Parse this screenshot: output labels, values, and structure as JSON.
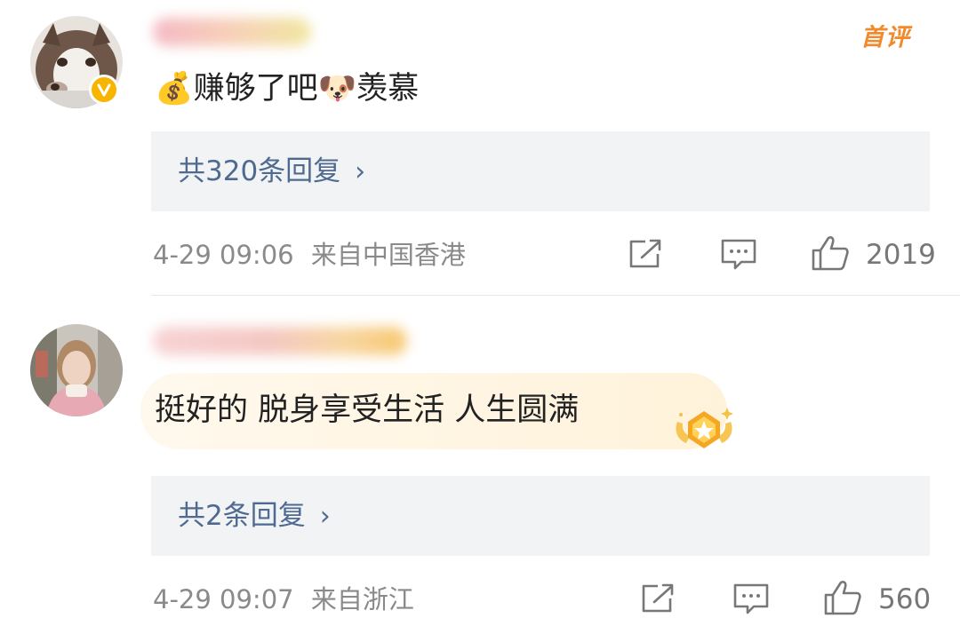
{
  "comments": [
    {
      "badge": "首评",
      "prefix_emoji": "💰",
      "text_part1": "赚够了吧",
      "inline_emoji": "🐶",
      "text_part2": "羡慕",
      "replies_label": "共320条回复",
      "timestamp": "4-29 09:06",
      "location": "来自中国香港",
      "like_count": "2019",
      "verified": true
    },
    {
      "text": "挺好的 脱身享受生活 人生圆满",
      "replies_label": "共2条回复",
      "timestamp": "4-29 09:07",
      "location": "来自浙江",
      "like_count": "560"
    }
  ],
  "icons": {
    "share": "share-icon",
    "comment": "comment-icon",
    "like": "thumbs-up-icon",
    "chevron": "chevron-right-icon",
    "verified": "verified-v-icon",
    "medal": "star-medal-icon"
  },
  "colors": {
    "link": "#4f6a91",
    "badge": "#f08a2c",
    "verified": "#f7b500",
    "reply_bg": "#f2f3f5",
    "meta": "#8a8a8a"
  }
}
